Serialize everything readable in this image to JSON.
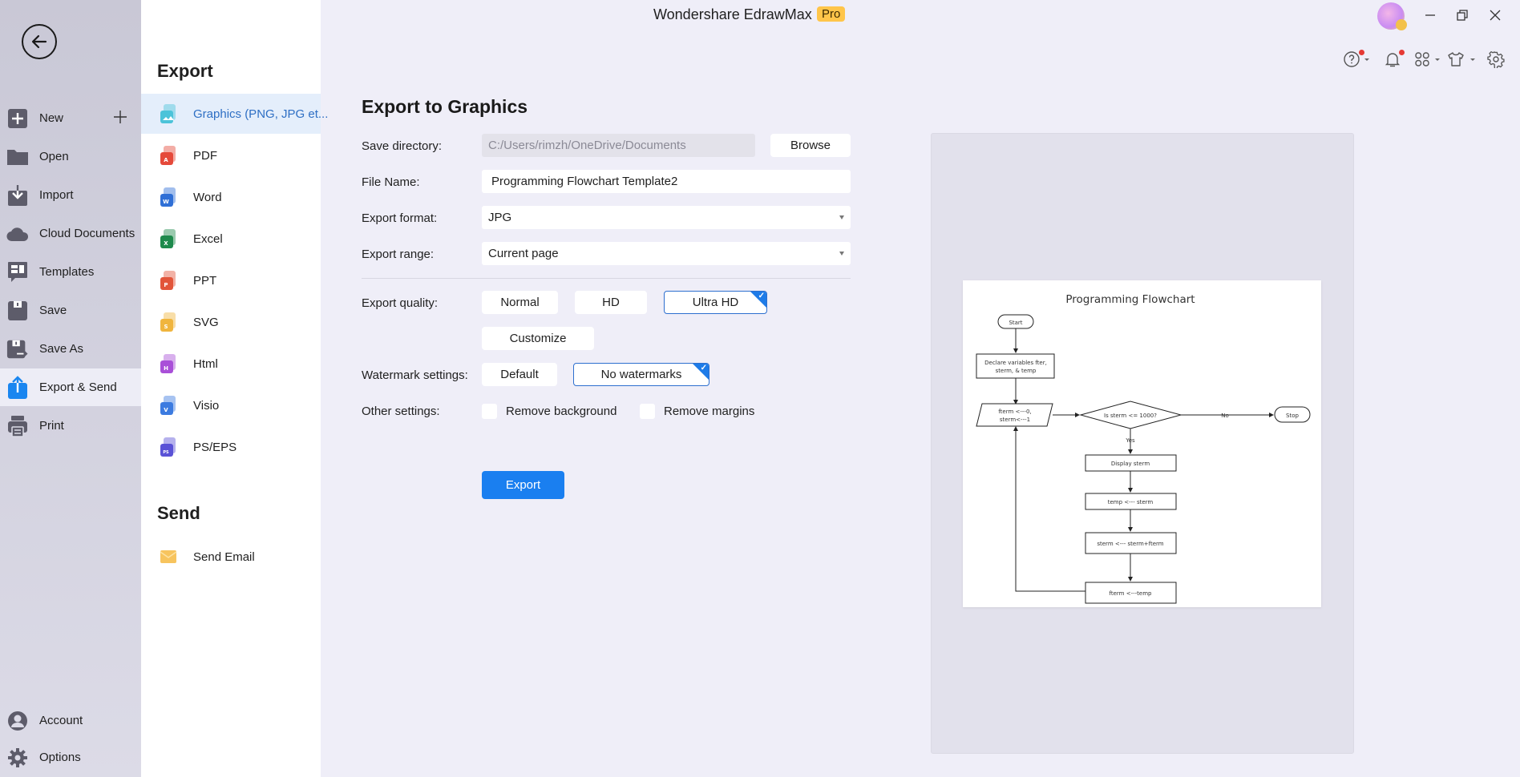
{
  "titlebar": {
    "app_name": "Wondershare EdrawMax",
    "badge": "Pro",
    "window_controls": [
      "minimize-icon",
      "restore-icon",
      "close-icon"
    ],
    "toolbar_icons": [
      "help-icon",
      "bell-icon",
      "apps-grid-icon",
      "theme-shirt-icon",
      "settings-gear-icon"
    ]
  },
  "sidebar": {
    "back_icon": "arrow-left-icon",
    "items": [
      {
        "label": "New",
        "icon": "plus-square-icon"
      },
      {
        "label": "Open",
        "icon": "folder-icon"
      },
      {
        "label": "Import",
        "icon": "import-icon"
      },
      {
        "label": "Cloud Documents",
        "icon": "cloud-icon"
      },
      {
        "label": "Templates",
        "icon": "templates-icon"
      },
      {
        "label": "Save",
        "icon": "save-icon"
      },
      {
        "label": "Save As",
        "icon": "save-as-icon"
      },
      {
        "label": "Export & Send",
        "icon": "export-icon",
        "active": true
      },
      {
        "label": "Print",
        "icon": "printer-icon"
      }
    ],
    "bottom_items": [
      {
        "label": "Account",
        "icon": "account-icon"
      },
      {
        "label": "Options",
        "icon": "gear-icon"
      }
    ]
  },
  "export_menu": {
    "export_heading": "Export",
    "formats": [
      {
        "label": "Graphics (PNG, JPG et...",
        "color": "#4cc3d9",
        "letter": "",
        "active": true
      },
      {
        "label": "PDF",
        "color": "#e5493a",
        "letter": "A"
      },
      {
        "label": "Word",
        "color": "#2f6fd6",
        "letter": "W"
      },
      {
        "label": "Excel",
        "color": "#1e8a4c",
        "letter": "X"
      },
      {
        "label": "PPT",
        "color": "#e2553a",
        "letter": "P"
      },
      {
        "label": "SVG",
        "color": "#f0b53e",
        "letter": "S"
      },
      {
        "label": "Html",
        "color": "#a94fd8",
        "letter": "H"
      },
      {
        "label": "Visio",
        "color": "#3c7be0",
        "letter": "V"
      },
      {
        "label": "PS/EPS",
        "color": "#5a52d6",
        "letter": "PS"
      }
    ],
    "send_heading": "Send",
    "send_items": [
      {
        "label": "Send Email",
        "color": "#f7c45e"
      }
    ]
  },
  "form": {
    "title": "Export to Graphics",
    "save_directory_label": "Save directory:",
    "save_directory_value": "C:/Users/rimzh/OneDrive/Documents",
    "browse_label": "Browse",
    "file_name_label": "File Name:",
    "file_name_value": "Programming Flowchart Template2",
    "export_format_label": "Export format:",
    "export_format_value": "JPG",
    "export_range_label": "Export range:",
    "export_range_value": "Current page",
    "export_quality_label": "Export quality:",
    "quality_options": [
      "Normal",
      "HD",
      "Ultra HD"
    ],
    "quality_selected": "Ultra HD",
    "customize_label": "Customize",
    "watermark_label": "Watermark settings:",
    "watermark_options": [
      "Default",
      "No watermarks"
    ],
    "watermark_selected": "No watermarks",
    "other_settings_label": "Other settings:",
    "remove_background_label": "Remove background",
    "remove_background_checked": false,
    "remove_margins_label": "Remove margins",
    "remove_margins_checked": false,
    "export_button_label": "Export"
  },
  "preview": {
    "title": "Programming Flowchart",
    "nodes": {
      "start": "Start",
      "declare_line1": "Declare variables fter,",
      "declare_line2": "sterm, & temp",
      "init_line1": "fterm <---0,",
      "init_line2": "sterm<---1",
      "decision": "Is sterm <= 1000?",
      "stop": "Stop",
      "display": "Display sterm",
      "temp": "temp <--- sterm",
      "sum": "sterm <--- sterm+fterm",
      "fterm": "fterm <---temp"
    },
    "edge_labels": {
      "no": "No",
      "yes": "Yes"
    }
  },
  "colors": {
    "accent": "#1a7ff0",
    "selected_border": "#2d6fcf",
    "active_format_text": "#2e6fc4",
    "pro_badge": "#ffc54a"
  }
}
